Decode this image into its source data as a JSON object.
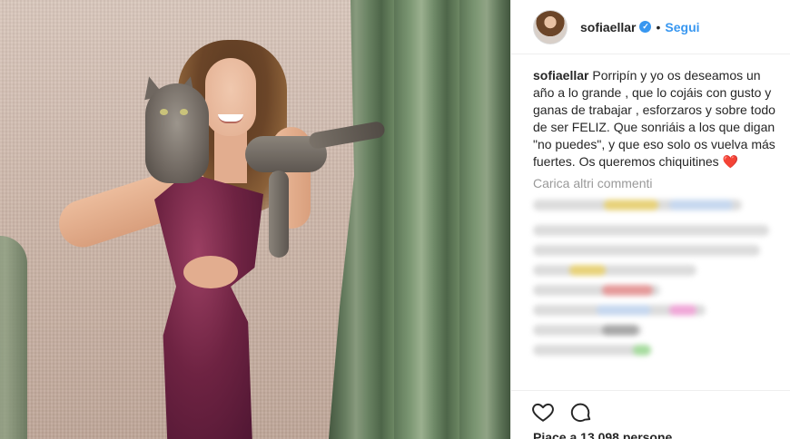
{
  "post": {
    "username": "sofiaellar",
    "separator": "•",
    "follow_label": "Segui",
    "verified_mark": "✓"
  },
  "caption": {
    "username": "sofiaellar",
    "text": "Porripín y yo os deseamos un año a lo grande , que lo cojáis con gusto y ganas de trabajar , esforzaros y sobre todo de ser FELIZ. Que sonriáis a los que digan \"no puedes\", y que eso solo os vuelva más fuertes. Os queremos chiquitines",
    "emoji": "❤️"
  },
  "comments": {
    "load_more_label": "Carica altri commenti"
  },
  "actions": {
    "like_icon": "heart-icon",
    "comment_icon": "comment-icon"
  },
  "likes": {
    "text": "Piace a 13.098 persone"
  },
  "colors": {
    "accent": "#3897f0",
    "text": "#262626",
    "muted": "#999999",
    "border": "#efefef"
  }
}
